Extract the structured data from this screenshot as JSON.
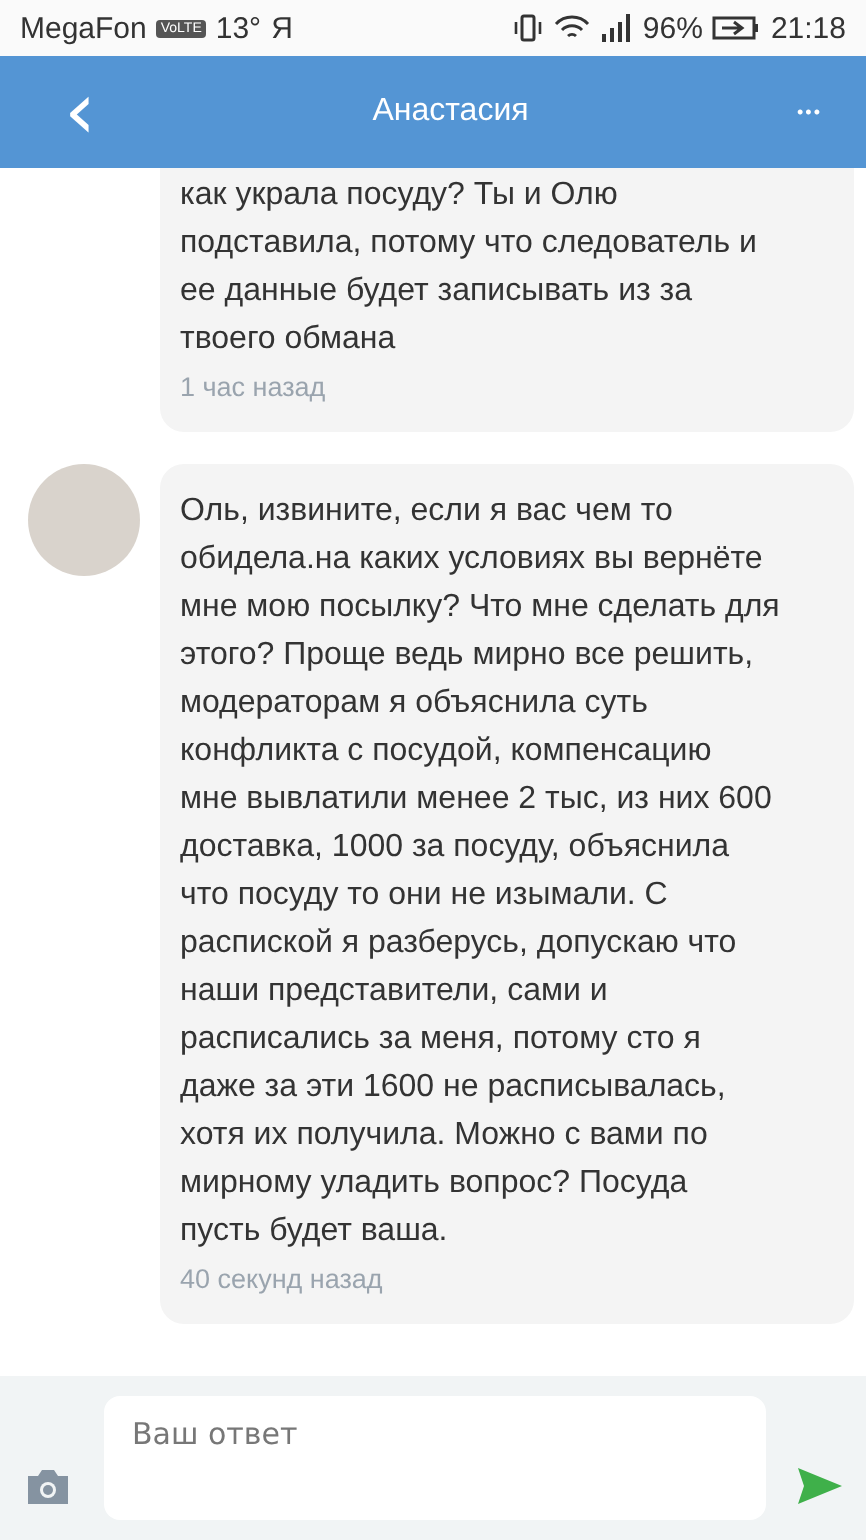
{
  "status_bar": {
    "carrier": "MegaFon",
    "network_badge": "VoLTE",
    "temperature": "13°",
    "app_glyph": "Я",
    "battery": "96%",
    "time": "21:18"
  },
  "header": {
    "title": "Анастасия",
    "back": "‹",
    "menu": "•••"
  },
  "messages": [
    {
      "kind": "own",
      "text": "как украла посуду? Ты и Олю\nподставила, потому что следователь и\nее данные будет записывать из за\nтвоего обмана",
      "time": "1 час назад"
    },
    {
      "kind": "incoming",
      "text": "Оль, извините, если я вас чем то\nобидела.на каких условиях вы вернёте\nмне мою посылку? Что мне сделать для\nэтого? Проще ведь мирно все решить,\nмодераторам я объяснила суть\nконфликта с посудой, компенсацию\nмне вывлатили менее 2 тыс, из них 600\nдоставка, 1000 за посуду, объяснила\nчто посуду то они не изымали. С\nраспиской я разберусь, допускаю что\nнаши представители, сами и\nрасписались за меня, потому сто я\nдаже за эти 1600 не расписывалась,\nхотя их получила. Можно с вами по\nмирному уладить вопрос? Посуда\nпусть будет ваша.",
      "time": "40 секунд назад"
    }
  ],
  "composer": {
    "placeholder": "Ваш ответ"
  }
}
